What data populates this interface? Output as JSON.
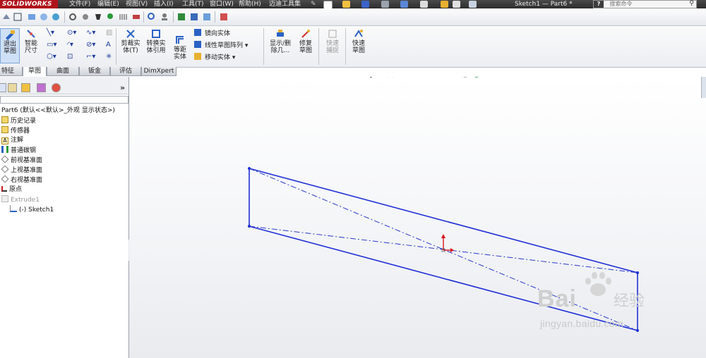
{
  "app": {
    "brand": "SOLIDWORKS",
    "window_title": "Sketch1 — Part6 *"
  },
  "menu": [
    "文件(F)",
    "编辑(E)",
    "视图(V)",
    "插入(I)",
    "工具(T)",
    "窗口(W)",
    "帮助(H)",
    "迈迪工具集"
  ],
  "search": {
    "placeholder": "搜索命令",
    "prefix": "?"
  },
  "ribbon": {
    "exit_sketch": "退出草图",
    "smart_dimension": "智能尺寸",
    "trim_entities": "剪裁实体(T)",
    "convert_entities": "转换实体引用",
    "offset_entities": "等距实体",
    "mirror_entities": "镜向实体",
    "linear_pattern": "线性草图阵列",
    "move_entities": "移动实体",
    "display_delete": "显示/删除几...",
    "repair_sketch": "修复草图",
    "quick_snaps": "快速捕捉",
    "rapid_sketch": "快速草图"
  },
  "tabs": [
    {
      "label": "特征",
      "active": false
    },
    {
      "label": "草图",
      "active": true
    },
    {
      "label": "曲面",
      "active": false
    },
    {
      "label": "钣金",
      "active": false
    },
    {
      "label": "评估",
      "active": false
    },
    {
      "label": "DimXpert",
      "active": false
    }
  ],
  "panel": {
    "collapse_glyph": "»"
  },
  "tree": [
    {
      "label": "Part6  (默认<<默认>_外观 显示状态>)",
      "icon": "part-icon"
    },
    {
      "label": "历史记录",
      "icon": "history-icon"
    },
    {
      "label": "传感器",
      "icon": "sensor-icon"
    },
    {
      "label": "注解",
      "icon": "annotation-icon"
    },
    {
      "label": "普通碳钢",
      "icon": "material-icon"
    },
    {
      "label": "前视基准面",
      "icon": "plane-icon"
    },
    {
      "label": "上视基准面",
      "icon": "plane-icon"
    },
    {
      "label": "右视基准面",
      "icon": "plane-icon"
    },
    {
      "label": "原点",
      "icon": "origin-icon"
    },
    {
      "label": "Extrude1",
      "icon": "extrude-icon"
    },
    {
      "label": "(-) Sketch1",
      "icon": "sketch-icon"
    }
  ],
  "watermark": {
    "logo": "Bai",
    "logo2": "经验",
    "url": "jingyan.baidu.com"
  },
  "colors": {
    "sketch_line": "#1f2fd6",
    "title_bar": "#333333",
    "brand_red": "#b0121b",
    "origin": "#d8151b"
  }
}
